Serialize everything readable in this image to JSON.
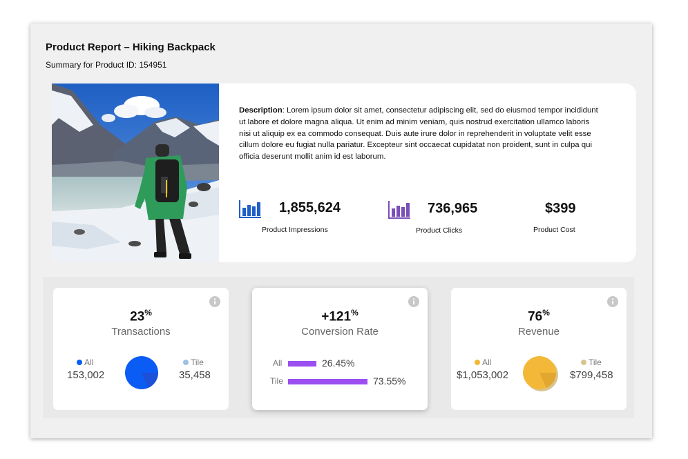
{
  "report": {
    "title": "Product Report – Hiking Backpack",
    "subtitle": "Summary for Product ID: 154951"
  },
  "product": {
    "image_icon": "hiker-photo",
    "description_label": "Description",
    "description_text": ": Lorem ipsum dolor sit amet, consectetur adipiscing elit, sed do eiusmod tempor incididunt ut labore et dolore magna aliqua. Ut enim ad minim veniam, quis nostrud exercitation ullamco laboris nisi ut aliquip ex ea commodo consequat. Duis aute irure dolor in reprehenderit in voluptate velit esse cillum dolore eu fugiat nulla pariatur. Excepteur sint occaecat cupidatat non proident, sunt in culpa qui officia deserunt mollit anim id est laborum.",
    "metrics": [
      {
        "value": "1,855,624",
        "label": "Product Impressions",
        "icon": "bar-chart-icon",
        "color": "#1f5fc9"
      },
      {
        "value": "736,965",
        "label": "Product Clicks",
        "icon": "bar-chart-icon",
        "color": "#7a4fb8"
      },
      {
        "value": "$399",
        "label": "Product Cost"
      }
    ]
  },
  "cards": [
    {
      "value": "23",
      "unit": "%",
      "title": "Transactions",
      "color": "#0a5cf5",
      "legend_color": "#9cc1e4",
      "legend_left": {
        "label": "All",
        "value": "153,002"
      },
      "legend_right": {
        "label": "Tile",
        "value": "35,458"
      },
      "info_icon": "info-icon"
    },
    {
      "value": "+121",
      "unit": "%",
      "title": "Conversion Rate",
      "color": "#9b4ff0",
      "bars": [
        {
          "label": "All",
          "value": "26.45%",
          "fraction": 0.2645
        },
        {
          "label": "Tile",
          "value": "73.55%",
          "fraction": 0.7355
        }
      ],
      "info_icon": "info-icon"
    },
    {
      "value": "76",
      "unit": "%",
      "title": "Revenue",
      "color": "#f3b837",
      "legend_color": "#d9c48f",
      "legend_left": {
        "label": "All",
        "value": "$1,053,002"
      },
      "legend_right": {
        "label": "Tile",
        "value": "$799,458"
      },
      "info_icon": "info-icon"
    }
  ]
}
